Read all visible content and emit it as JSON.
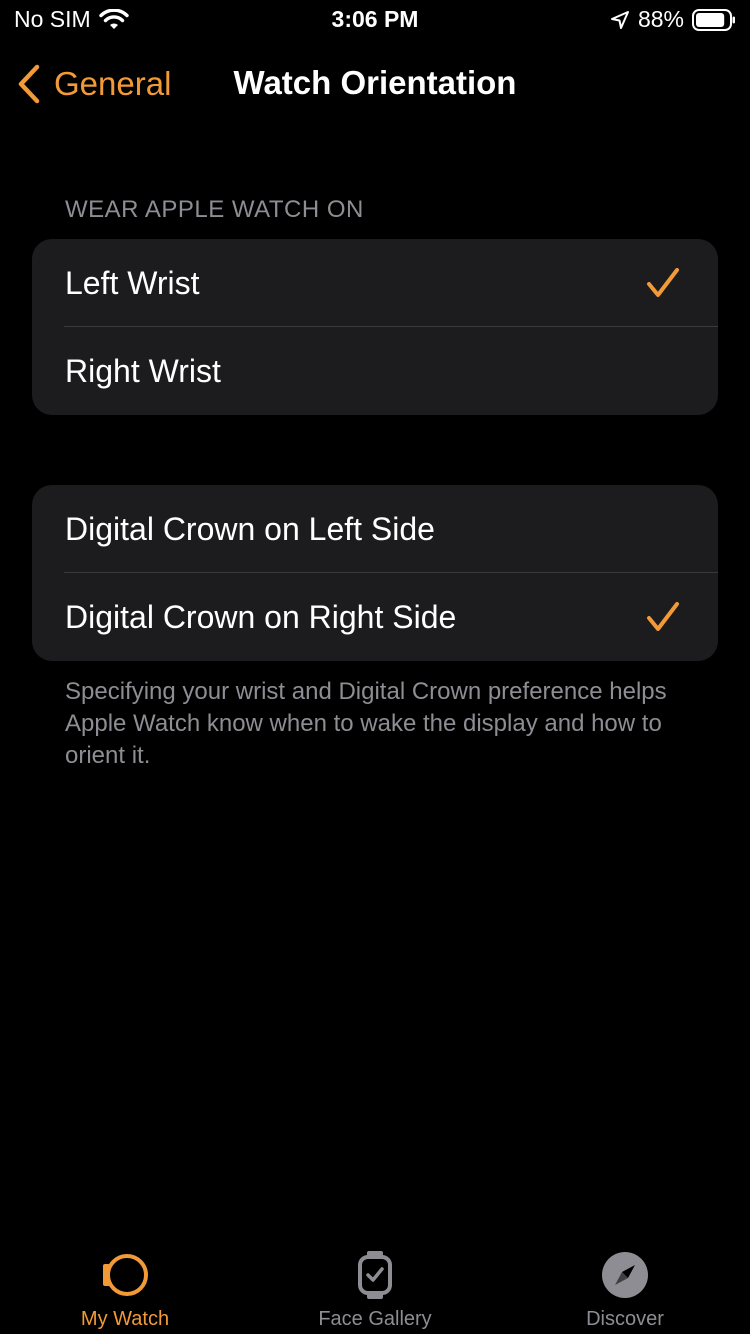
{
  "colors": {
    "accent": "#f19a37",
    "background": "#000000",
    "group_background": "#1c1c1e",
    "secondary_text": "#8d8d93",
    "divider": "#3a3a3c"
  },
  "status_bar": {
    "carrier": "No SIM",
    "time": "3:06 PM",
    "battery_percent": "88%",
    "battery_level": 0.88,
    "icons": [
      "wifi-icon",
      "location-arrow-icon",
      "battery-icon"
    ]
  },
  "nav": {
    "back_label": "General",
    "title": "Watch Orientation"
  },
  "wrist_section": {
    "header": "WEAR APPLE WATCH ON",
    "options": [
      {
        "label": "Left Wrist",
        "selected": true
      },
      {
        "label": "Right Wrist",
        "selected": false
      }
    ]
  },
  "crown_section": {
    "options": [
      {
        "label": "Digital Crown on Left Side",
        "selected": false
      },
      {
        "label": "Digital Crown on Right Side",
        "selected": true
      }
    ],
    "footer": "Specifying your wrist and Digital Crown preference helps Apple Watch know when to wake the display and how to orient it."
  },
  "tab_bar": {
    "tabs": [
      {
        "label": "My Watch",
        "icon": "my-watch-icon",
        "active": true
      },
      {
        "label": "Face Gallery",
        "icon": "face-gallery-icon",
        "active": false
      },
      {
        "label": "Discover",
        "icon": "compass-icon",
        "active": false
      }
    ]
  }
}
